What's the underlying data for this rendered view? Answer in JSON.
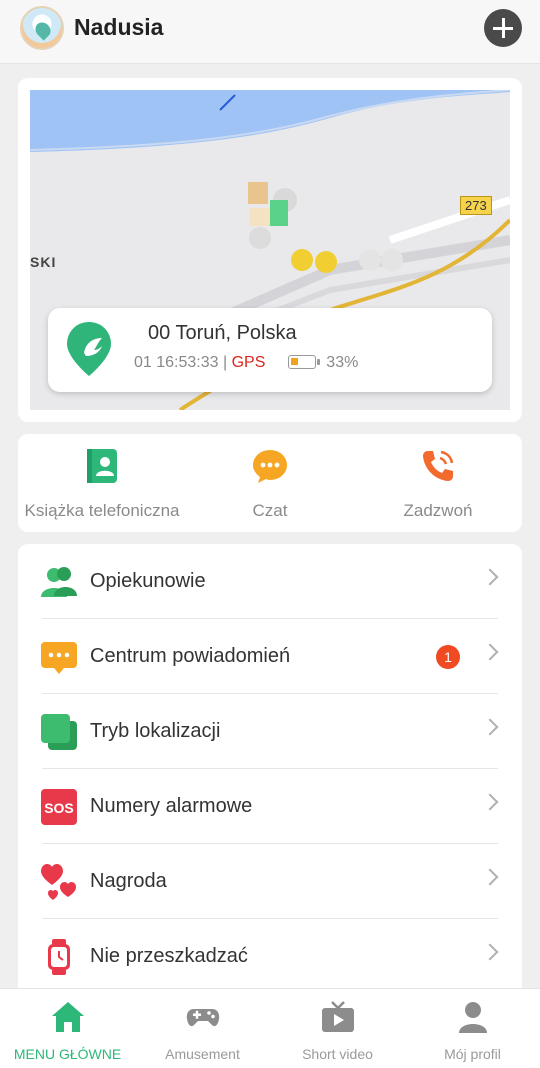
{
  "header": {
    "title": "Nadusia"
  },
  "map": {
    "route_number": "273",
    "place_label": "SKI",
    "address": "00 Toruń, Polska",
    "time": "01 16:53:33",
    "separator": "|",
    "source": "GPS",
    "battery": "33%",
    "battery_level": 0.33
  },
  "actions": [
    {
      "label": "Książka telefoniczna"
    },
    {
      "label": "Czat"
    },
    {
      "label": "Zadzwoń"
    }
  ],
  "menu": [
    {
      "label": "Opiekunowie"
    },
    {
      "label": "Centrum powiadomień",
      "badge": "1"
    },
    {
      "label": "Tryb lokalizacji"
    },
    {
      "label": "Numery alarmowe",
      "icon_text": "SOS"
    },
    {
      "label": "Nagroda"
    },
    {
      "label": "Nie przeszkadzać"
    }
  ],
  "nav": [
    {
      "label": "MENU GŁÓWNE",
      "active": true
    },
    {
      "label": "Amusement"
    },
    {
      "label": "Short video"
    },
    {
      "label": "Mój profil"
    }
  ],
  "colors": {
    "accent": "#2db87a",
    "badge": "#f04a22",
    "gps": "#d9261c",
    "water": "#9fc3f5"
  }
}
